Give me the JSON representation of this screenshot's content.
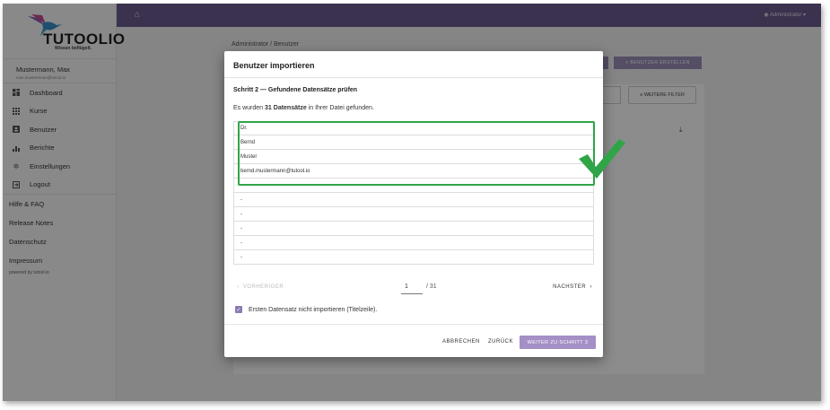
{
  "brand": {
    "name": "TUTOOLIO",
    "tagline": "Wissen beflügelt."
  },
  "user": {
    "name": "Mustermann, Max",
    "email": "max.mustermann@tutool.io"
  },
  "sidebar": {
    "items": [
      {
        "label": "Dashboard",
        "icon": "dashboard-icon"
      },
      {
        "label": "Kurse",
        "icon": "grid-icon"
      },
      {
        "label": "Benutzer",
        "icon": "user-card-icon"
      },
      {
        "label": "Berichte",
        "icon": "bar-chart-icon"
      },
      {
        "label": "Einstellungen",
        "icon": "gear-icon"
      },
      {
        "label": "Logout",
        "icon": "logout-icon"
      }
    ],
    "links": [
      "Hilfe & FAQ",
      "Release Notes",
      "Datenschutz",
      "Impressum"
    ],
    "powered": "powered by tutool.io"
  },
  "topbar": {
    "admin_label": "Administrator"
  },
  "background": {
    "breadcrumb": "Administrator / Benutzer",
    "create_user_label": "+ BENUTZER ERSTELLEN",
    "more_filters_label": "WEITERE FILTER"
  },
  "dialog": {
    "title": "Benutzer importieren",
    "step_title": "Schritt 2 — Gefundene Datensätze prüfen",
    "found_prefix": "Es wurden ",
    "found_count": "31 Datensätze",
    "found_suffix": " in Ihrer Datei gefunden.",
    "records": [
      "Dr.",
      "Bernd",
      "Muster",
      "bernd.mustermann@tutool.io",
      "-",
      "-",
      "-",
      "-",
      "-",
      "-"
    ],
    "pager": {
      "prev_label": "VORHERIGER",
      "page": "1",
      "total": "/ 31",
      "next_label": "NACHSTER"
    },
    "checkbox_label": "Ersten Datensatz nicht importieren (Titelzeile).",
    "checkbox_checked": true,
    "buttons": {
      "cancel": "ABBRECHEN",
      "back": "ZURÜCK",
      "next_step": "WEITER ZU SCHRITT 3"
    }
  },
  "colors": {
    "topbar": "#6b5b8e",
    "accent": "#a48fc6",
    "highlight": "#2fa548"
  }
}
